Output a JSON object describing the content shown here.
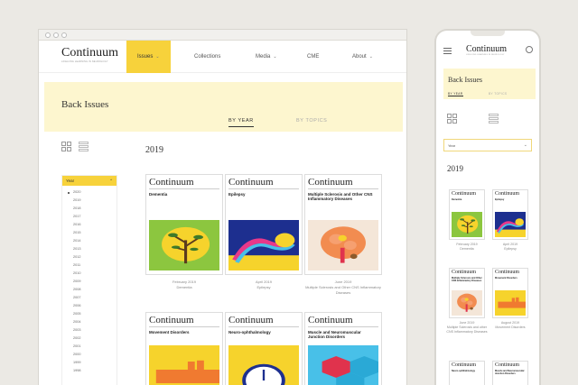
{
  "desktop": {
    "brand": {
      "title": "Continuum",
      "tagline": "Lifelong Learning in Neurology"
    },
    "nav": [
      {
        "label": "Issues",
        "chevron": true,
        "active": true
      },
      {
        "label": "Collections",
        "chevron": false
      },
      {
        "label": "Media",
        "chevron": true
      },
      {
        "label": "CME",
        "chevron": false
      },
      {
        "label": "About",
        "chevron": true
      }
    ],
    "page_title": "Back Issues",
    "tabs": [
      "By Year",
      "By Topics"
    ],
    "year_heading": "2019",
    "sidebar": {
      "header": "Year",
      "years": [
        "2020",
        "2019",
        "2018",
        "2017",
        "2016",
        "2015",
        "2014",
        "2013",
        "2012",
        "2011",
        "2010",
        "2009",
        "2008",
        "2007",
        "2006",
        "2005",
        "2004",
        "2003",
        "2002",
        "2001",
        "2000",
        "1999",
        "1998"
      ]
    },
    "covers": [
      {
        "brand": "Continuum",
        "title": "Dementia",
        "date": "February 2019",
        "topic": "Dementia",
        "art": "dementia"
      },
      {
        "brand": "Continuum",
        "title": "Epilepsy",
        "date": "April 2019",
        "topic": "Epilepsy",
        "art": "epilepsy"
      },
      {
        "brand": "Continuum",
        "title": "Multiple Sclerosis and Other CNS Inflammatory Diseases",
        "date": "June 2019",
        "topic": "Multiple Sclerosis and Other CNS Inflammatory Diseases",
        "art": "ms"
      },
      {
        "brand": "Continuum",
        "title": "Movement Disorders",
        "art": "movement"
      },
      {
        "brand": "Continuum",
        "title": "Neuro-ophthalmology",
        "art": "neuro"
      },
      {
        "brand": "Continuum",
        "title": "Muscle and Neuromuscular Junction Disorders",
        "art": "muscle"
      }
    ]
  },
  "mobile": {
    "brand": {
      "title": "Continuum",
      "tagline": "Lifelong Learning in Neurology"
    },
    "page_title": "Back Issues",
    "tabs": [
      "By Year",
      "By Topics"
    ],
    "select": {
      "value": "Year"
    },
    "year_heading": "2019",
    "covers": [
      {
        "brand": "Continuum",
        "title": "Dementia",
        "date": "February 2019",
        "topic": "Dementia",
        "art": "dementia"
      },
      {
        "brand": "Continuum",
        "title": "Epilepsy",
        "date": "April 2019",
        "topic": "Epilepsy",
        "art": "epilepsy"
      },
      {
        "brand": "Continuum",
        "title": "Multiple Sclerosis and Other CNS Inflammatory Diseases",
        "date": "June 2019",
        "topic": "Multiple Sclerosis and other CNS Inflammatory Diseases",
        "art": "ms"
      },
      {
        "brand": "Continuum",
        "title": "Movement Disorders",
        "date": "August 2019",
        "topic": "Movement Disorders",
        "art": "movement"
      },
      {
        "brand": "Continuum",
        "title": "Neuro-ophthalmology",
        "art": "neuro"
      },
      {
        "brand": "Continuum",
        "title": "Muscle and Neuromuscular Junction Disorders",
        "art": "muscle"
      }
    ]
  },
  "colors": {
    "accent": "#f7d23b",
    "banner": "#fdf6cf"
  }
}
